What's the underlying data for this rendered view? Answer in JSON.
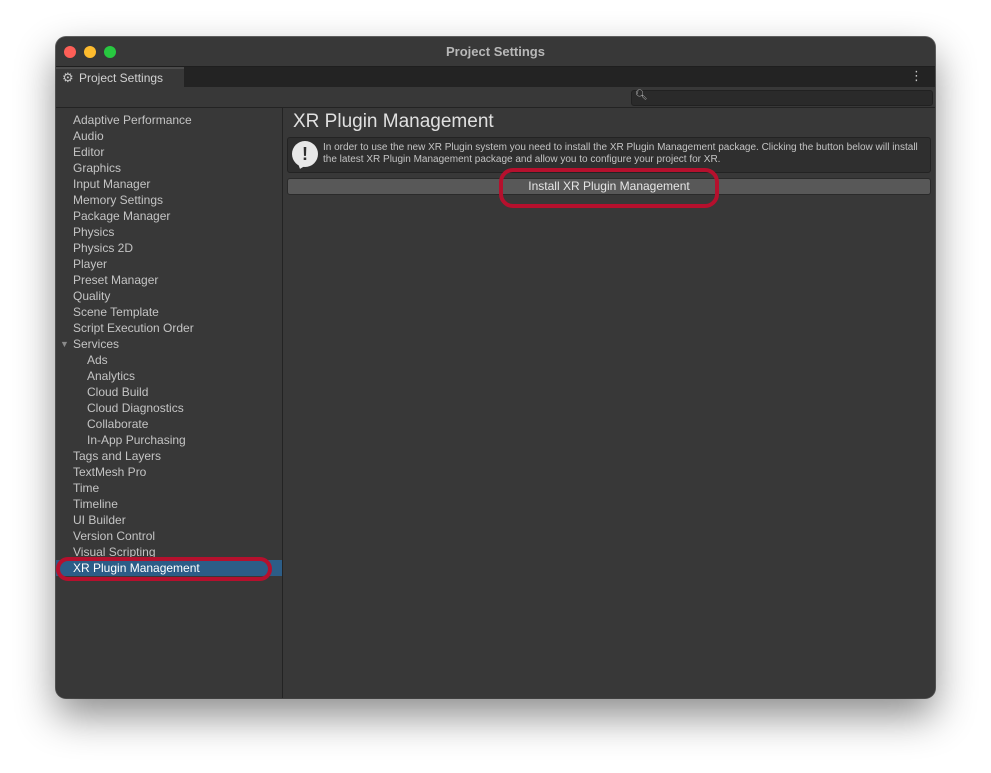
{
  "window": {
    "title": "Project Settings"
  },
  "tab": {
    "label": "Project Settings",
    "icon": "gear-icon"
  },
  "search": {
    "placeholder": "",
    "value": ""
  },
  "sidebar": {
    "items": [
      {
        "label": "Adaptive Performance",
        "level": 0
      },
      {
        "label": "Audio",
        "level": 0
      },
      {
        "label": "Editor",
        "level": 0
      },
      {
        "label": "Graphics",
        "level": 0
      },
      {
        "label": "Input Manager",
        "level": 0
      },
      {
        "label": "Memory Settings",
        "level": 0
      },
      {
        "label": "Package Manager",
        "level": 0
      },
      {
        "label": "Physics",
        "level": 0
      },
      {
        "label": "Physics 2D",
        "level": 0
      },
      {
        "label": "Player",
        "level": 0
      },
      {
        "label": "Preset Manager",
        "level": 0
      },
      {
        "label": "Quality",
        "level": 0
      },
      {
        "label": "Scene Template",
        "level": 0
      },
      {
        "label": "Script Execution Order",
        "level": 0
      },
      {
        "label": "Services",
        "level": 0,
        "expanded": true
      },
      {
        "label": "Ads",
        "level": 1
      },
      {
        "label": "Analytics",
        "level": 1
      },
      {
        "label": "Cloud Build",
        "level": 1
      },
      {
        "label": "Cloud Diagnostics",
        "level": 1
      },
      {
        "label": "Collaborate",
        "level": 1
      },
      {
        "label": "In-App Purchasing",
        "level": 1
      },
      {
        "label": "Tags and Layers",
        "level": 0
      },
      {
        "label": "TextMesh Pro",
        "level": 0
      },
      {
        "label": "Time",
        "level": 0
      },
      {
        "label": "Timeline",
        "level": 0
      },
      {
        "label": "UI Builder",
        "level": 0
      },
      {
        "label": "Version Control",
        "level": 0
      },
      {
        "label": "Visual Scripting",
        "level": 0
      },
      {
        "label": "XR Plugin Management",
        "level": 0,
        "selected": true
      }
    ]
  },
  "main": {
    "title": "XR Plugin Management",
    "help_message": "In order to use the new XR Plugin system you need to install the XR Plugin Management package. Clicking the button below will install the latest XR Plugin Management package and allow you to configure your project for XR.",
    "install_button_label": "Install XR Plugin Management"
  },
  "colors": {
    "selection": "#2c5d87",
    "annotation_ring": "#b5102d"
  }
}
